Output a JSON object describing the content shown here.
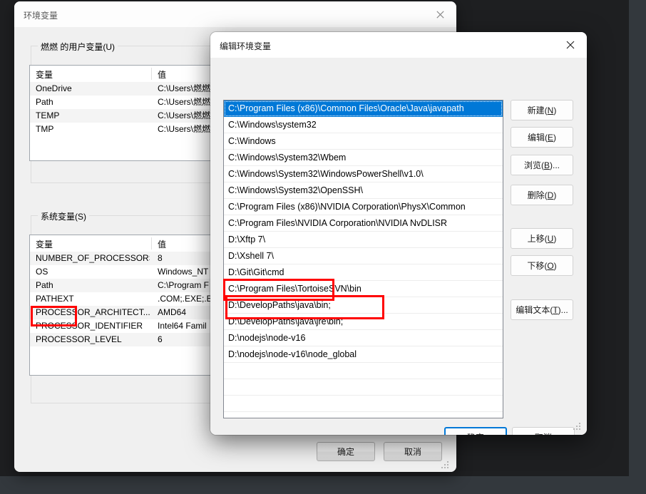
{
  "main_window": {
    "title": "环境变量",
    "close_icon": "close-icon",
    "user_group": {
      "legend": "燃燃 的用户变量(U)",
      "columns": [
        "变量",
        "值"
      ],
      "rows": [
        {
          "name": "OneDrive",
          "value": "C:\\Users\\燃燃"
        },
        {
          "name": "Path",
          "value": "C:\\Users\\燃燃"
        },
        {
          "name": "TEMP",
          "value": "C:\\Users\\燃燃"
        },
        {
          "name": "TMP",
          "value": "C:\\Users\\燃燃"
        }
      ]
    },
    "system_group": {
      "legend": "系统变量(S)",
      "columns": [
        "变量",
        "值"
      ],
      "rows": [
        {
          "name": "NUMBER_OF_PROCESSORS",
          "value": "8"
        },
        {
          "name": "OS",
          "value": "Windows_NT"
        },
        {
          "name": "Path",
          "value": "C:\\Program F"
        },
        {
          "name": "PATHEXT",
          "value": ".COM;.EXE;.B"
        },
        {
          "name": "PROCESSOR_ARCHITECT...",
          "value": "AMD64"
        },
        {
          "name": "PROCESSOR_IDENTIFIER",
          "value": "Intel64 Famil"
        },
        {
          "name": "PROCESSOR_LEVEL",
          "value": "6"
        }
      ]
    },
    "ok_label": "确定",
    "cancel_label": "取消"
  },
  "edit_dialog": {
    "title": "编辑环境变量",
    "close_icon": "close-icon",
    "path_entries": [
      "C:\\Program Files (x86)\\Common Files\\Oracle\\Java\\javapath",
      "C:\\Windows\\system32",
      "C:\\Windows",
      "C:\\Windows\\System32\\Wbem",
      "C:\\Windows\\System32\\WindowsPowerShell\\v1.0\\",
      "C:\\Windows\\System32\\OpenSSH\\",
      "C:\\Program Files (x86)\\NVIDIA Corporation\\PhysX\\Common",
      "C:\\Program Files\\NVIDIA Corporation\\NVIDIA NvDLISR",
      "D:\\Xftp 7\\",
      "D:\\Xshell 7\\",
      "D:\\Git\\Git\\cmd",
      "C:\\Program Files\\TortoiseSVN\\bin",
      "D:\\DevelopPaths\\java\\bin;",
      "D:\\DevelopPaths\\java\\jre\\bin;",
      "D:\\nodejs\\node-v16",
      "D:\\nodejs\\node-v16\\node_global",
      "",
      "",
      "",
      ""
    ],
    "selected_index": 0,
    "side_buttons": [
      {
        "label_prefix": "新建(",
        "accel": "N",
        "label_suffix": ")"
      },
      {
        "label_prefix": "编辑(",
        "accel": "E",
        "label_suffix": ")"
      },
      {
        "label_prefix": "浏览(",
        "accel": "B",
        "label_suffix": ")..."
      },
      {
        "label_prefix": "删除(",
        "accel": "D",
        "label_suffix": ")"
      },
      {
        "label_prefix": "上移(",
        "accel": "U",
        "label_suffix": ")"
      },
      {
        "label_prefix": "下移(",
        "accel": "O",
        "label_suffix": ")"
      },
      {
        "label_prefix": "编辑文本(",
        "accel": "T",
        "label_suffix": ")..."
      }
    ],
    "ok_label": "确定",
    "cancel_label": "取消"
  },
  "annotations": {
    "color": "#ff0000",
    "boxes": [
      {
        "target": "system-path-row"
      },
      {
        "target": "path-entry-nodejs"
      },
      {
        "target": "path-entry-node-global"
      }
    ]
  }
}
